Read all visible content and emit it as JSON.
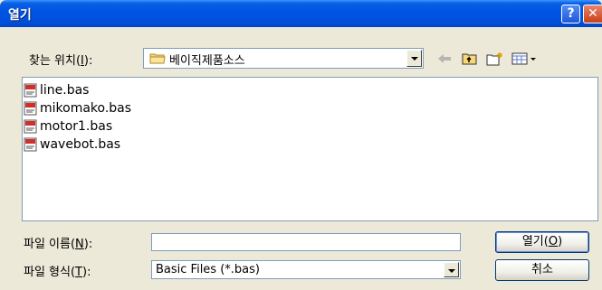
{
  "window": {
    "title": "열기",
    "help_icon": "question-mark-icon",
    "close_icon": "close-icon"
  },
  "location": {
    "label_prefix": "찾는 위치(",
    "label_key": "I",
    "label_suffix": "):",
    "current_folder": "베이직제품소스",
    "folder_icon": "folder-icon"
  },
  "toolbar": {
    "back_icon": "back-arrow-icon",
    "up_icon": "up-folder-icon",
    "new_folder_icon": "new-folder-icon",
    "view_menu_icon": "view-menu-icon"
  },
  "files": [
    {
      "name": "line.bas"
    },
    {
      "name": "mikomako.bas"
    },
    {
      "name": "motor1.bas"
    },
    {
      "name": "wavebot.bas"
    }
  ],
  "filename": {
    "label_prefix": "파일 이름(",
    "label_key": "N",
    "label_suffix": "):",
    "value": ""
  },
  "filetype": {
    "label_prefix": "파일 형식(",
    "label_key": "T",
    "label_suffix": "):",
    "selected": "Basic Files (*.bas)"
  },
  "buttons": {
    "open_prefix": "열기(",
    "open_key": "O",
    "open_suffix": ")",
    "cancel": "취소"
  },
  "colors": {
    "titlebar": "#0055E5",
    "dialog_bg": "#ECE9D8",
    "border": "#7F9DB9"
  }
}
